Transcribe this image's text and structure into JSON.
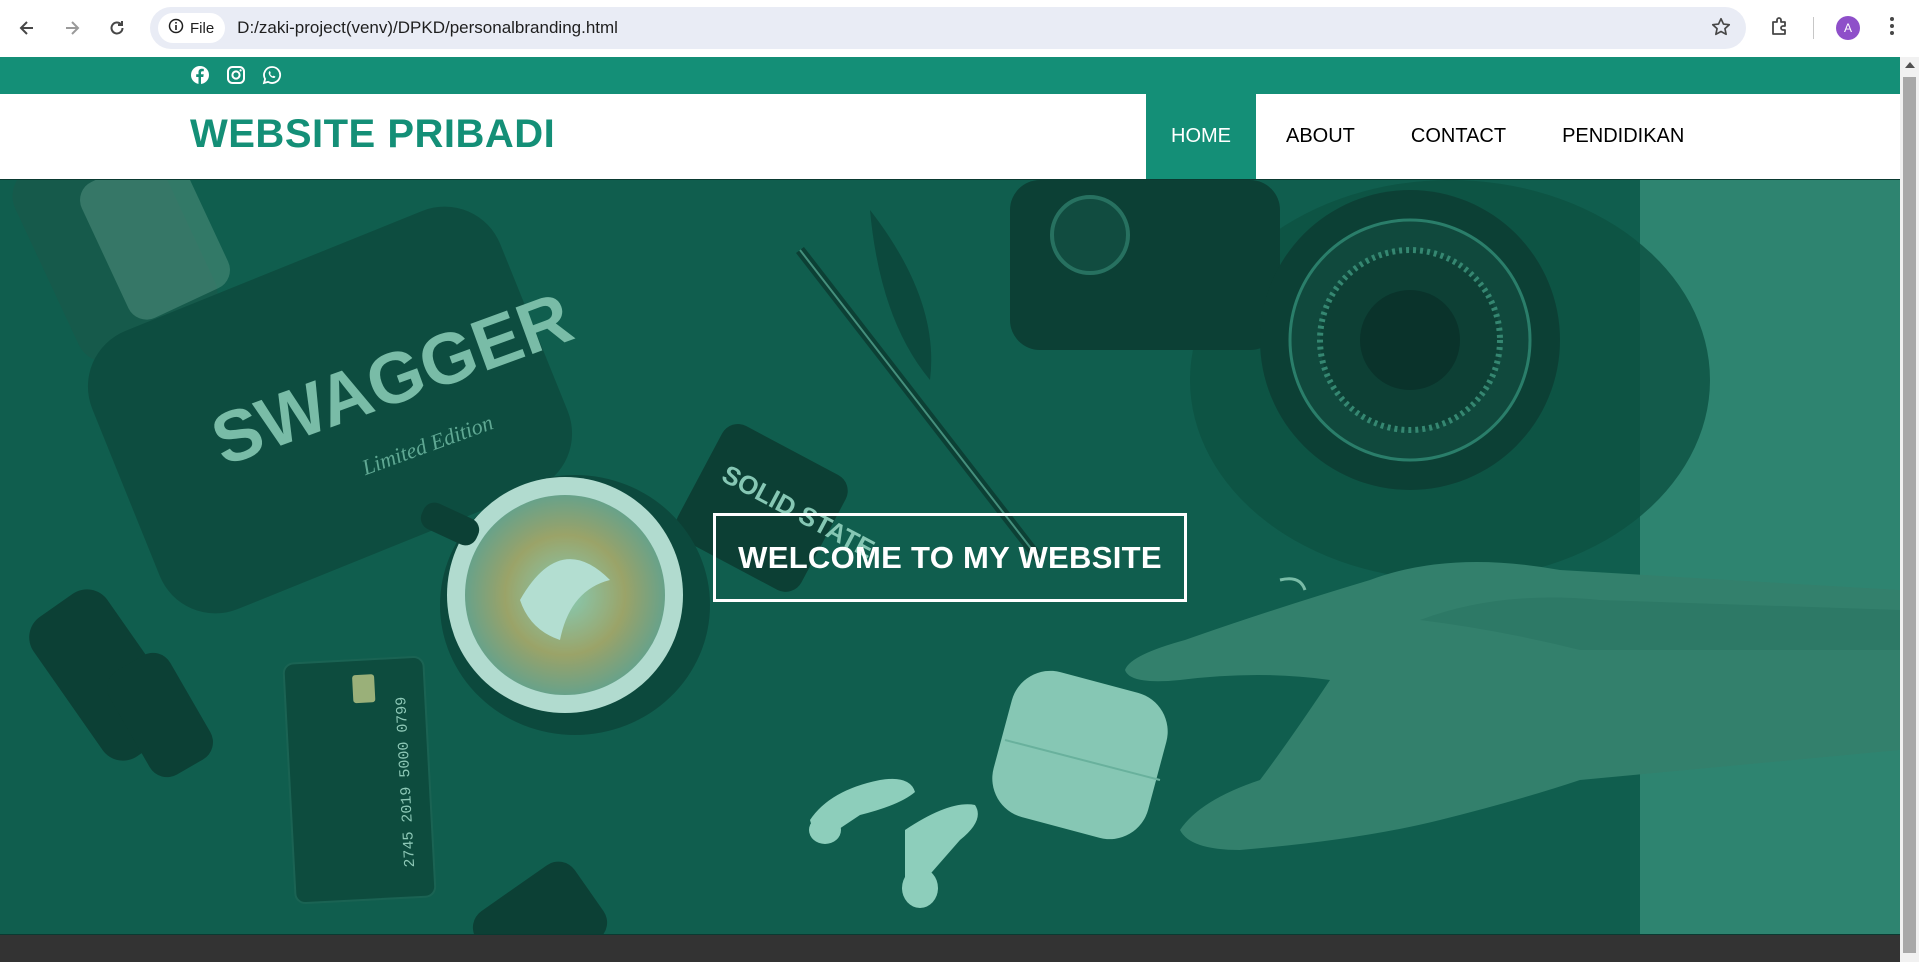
{
  "browser": {
    "site_chip_label": "File",
    "url": "D:/zaki-project(venv)/DPKD/personalbranding.html",
    "avatar_letter": "A"
  },
  "page": {
    "social_icons": [
      "facebook-icon",
      "instagram-icon",
      "whatsapp-icon"
    ],
    "logo": "WEBSITE PRIBADI",
    "menu": [
      {
        "label": "HOME",
        "active": true
      },
      {
        "label": "ABOUT",
        "active": false
      },
      {
        "label": "CONTACT",
        "active": false
      },
      {
        "label": "PENDIDIKAN",
        "active": false
      }
    ],
    "hero": {
      "welcome": "WELCOME TO MY WEBSITE",
      "product_text": "SWAGGER",
      "product_subtext": "Limited Edition",
      "phone_text": "SOLID STATE",
      "card_number": "2745 2019 5000 0799"
    },
    "colors": {
      "accent": "#148f77",
      "footer": "#333333"
    }
  }
}
